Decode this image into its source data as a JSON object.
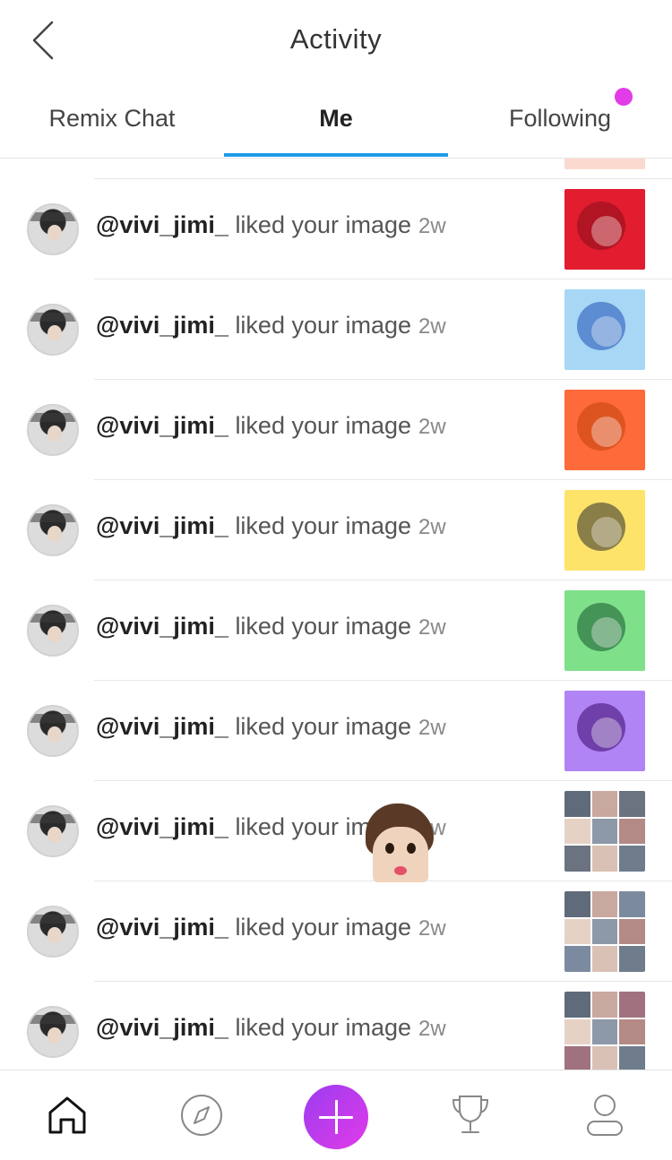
{
  "header": {
    "title": "Activity",
    "back_icon": "chevron-left-icon"
  },
  "tabs": [
    {
      "label": "Remix Chat"
    },
    {
      "label": "Me",
      "active": true
    },
    {
      "label": "Following",
      "has_notification": true
    }
  ],
  "colors": {
    "accent_tab": "#1f9be8",
    "notification_dot": "#e23be8",
    "fab_gradient_start": "#9a3cf0",
    "fab_gradient_end": "#e23be8"
  },
  "notifications": [
    {
      "user": "@vivi_jimi_",
      "action": "liked your image",
      "time": "2w",
      "thumb_color": "#e11d2f",
      "thumb_accent": "#8a0c1a"
    },
    {
      "user": "@vivi_jimi_",
      "action": "liked your image",
      "time": "2w",
      "thumb_color": "#a7d7f5",
      "thumb_accent": "#1f4fb5"
    },
    {
      "user": "@vivi_jimi_",
      "action": "liked your image",
      "time": "2w",
      "thumb_color": "#ff6a3a",
      "thumb_accent": "#c2410c"
    },
    {
      "user": "@vivi_jimi_",
      "action": "liked your image",
      "time": "2w",
      "thumb_color": "#fde36a",
      "thumb_accent": "#2b2b2b"
    },
    {
      "user": "@vivi_jimi_",
      "action": "liked your image",
      "time": "2w",
      "thumb_color": "#7fe08a",
      "thumb_accent": "#14532d"
    },
    {
      "user": "@vivi_jimi_",
      "action": "liked your image",
      "time": "2w",
      "thumb_color": "#b184f5",
      "thumb_accent": "#3b0a6b"
    },
    {
      "user": "@vivi_jimi_",
      "action": "liked your image",
      "time": "2w",
      "thumb_color": "grid",
      "thumb_accent": "#6b7280"
    },
    {
      "user": "@vivi_jimi_",
      "action": "liked your image",
      "time": "2w",
      "thumb_color": "grid",
      "thumb_accent": "#7c8aa0"
    },
    {
      "user": "@vivi_jimi_",
      "action": "liked your image",
      "time": "2w",
      "thumb_color": "grid",
      "thumb_accent": "#a0727f"
    }
  ],
  "bottom_nav": [
    {
      "icon": "home-icon",
      "active": true
    },
    {
      "icon": "compass-icon"
    },
    {
      "icon": "plus-icon"
    },
    {
      "icon": "trophy-icon"
    },
    {
      "icon": "profile-icon"
    }
  ]
}
